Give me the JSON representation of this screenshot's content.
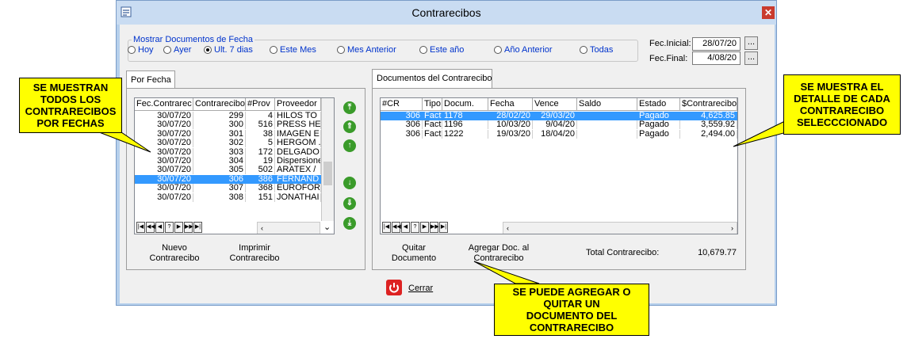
{
  "window": {
    "title": "Contrarecibos",
    "close_glyph": "✕"
  },
  "filter": {
    "legend": "Mostrar Documentos de Fecha",
    "options": [
      {
        "label": "Hoy",
        "selected": false
      },
      {
        "label": "Ayer",
        "selected": false
      },
      {
        "label": "Ult. 7 dias",
        "selected": true
      },
      {
        "label": "Este Mes",
        "selected": false
      },
      {
        "label": "Mes Anterior",
        "selected": false
      },
      {
        "label": "Este año",
        "selected": false
      },
      {
        "label": "Año Anterior",
        "selected": false
      },
      {
        "label": "Todas",
        "selected": false
      }
    ],
    "fec_inicial_label": "Fec.Inicial:",
    "fec_inicial_value": "28/07/20",
    "fec_final_label": "Fec.Final:",
    "fec_final_value": "4/08/20",
    "ellipsis": "..."
  },
  "left_panel": {
    "tab": "Por Fecha",
    "headers": [
      "Fec.Contrarec",
      "Contrarecibo",
      "#Prov",
      "Proveedor"
    ],
    "rows": [
      {
        "fecha": "30/07/20",
        "cr": "299",
        "prov": "4",
        "nombre": "HILOS TO"
      },
      {
        "fecha": "30/07/20",
        "cr": "300",
        "prov": "516",
        "nombre": "PRESS HE"
      },
      {
        "fecha": "30/07/20",
        "cr": "301",
        "prov": "38",
        "nombre": "IMAGEN E"
      },
      {
        "fecha": "30/07/20",
        "cr": "302",
        "prov": "5",
        "nombre": "HERGOM ."
      },
      {
        "fecha": "30/07/20",
        "cr": "303",
        "prov": "172",
        "nombre": "DELGADO"
      },
      {
        "fecha": "30/07/20",
        "cr": "304",
        "prov": "19",
        "nombre": "Dispersione"
      },
      {
        "fecha": "30/07/20",
        "cr": "305",
        "prov": "502",
        "nombre": "ARATEX /"
      },
      {
        "fecha": "30/07/20",
        "cr": "306",
        "prov": "386",
        "nombre": "FERNAND"
      },
      {
        "fecha": "30/07/20",
        "cr": "307",
        "prov": "368",
        "nombre": "EUROFOR"
      },
      {
        "fecha": "30/07/20",
        "cr": "308",
        "prov": "151",
        "nombre": "JONATHAI"
      }
    ],
    "selected_index": 7,
    "nav_glyphs": [
      "|◀",
      "◀◀",
      "◀",
      "?",
      "▶",
      "▶▶",
      "▶|"
    ],
    "btn_nuevo": "Nuevo\nContrarecibo",
    "btn_imprimir": "Imprimir\nContrarecibo"
  },
  "right_panel": {
    "tab": "Documentos del Contrarecibo",
    "headers": [
      "#CR",
      "Tipo",
      "Docum.",
      "Fecha",
      "Vence",
      "Saldo",
      "Estado",
      "$Contrarecibo"
    ],
    "rows": [
      {
        "cr": "306",
        "tipo": "Fact",
        "docum": "1178",
        "fecha": "28/02/20",
        "vence": "29/03/20",
        "saldo": "",
        "estado": "Pagado",
        "monto": "4,625.85"
      },
      {
        "cr": "306",
        "tipo": "Fact",
        "docum": "1196",
        "fecha": "10/03/20",
        "vence": "9/04/20",
        "saldo": "",
        "estado": "Pagado",
        "monto": "3,559.92"
      },
      {
        "cr": "306",
        "tipo": "Fact",
        "docum": "1222",
        "fecha": "19/03/20",
        "vence": "18/04/20",
        "saldo": "",
        "estado": "Pagado",
        "monto": "2,494.00"
      }
    ],
    "selected_index": 0,
    "btn_quitar": "Quitar\nDocumento",
    "btn_agregar": "Agregar Doc. al\nContrarecibo",
    "total_label": "Total Contrarecibo:",
    "total_value": "10,679.77"
  },
  "cerrar": {
    "label": "Cerrar"
  },
  "callouts": {
    "left": "SE MUESTRAN\nTODOS LOS\nCONTRARECIBOS\nPOR FECHAS",
    "right": "SE MUESTRA EL\nDETALLE DE CADA\nCONTRARECIBO\nSELECCCIONADO",
    "bottom": "SE PUEDE AGREGAR O\nQUITAR UN\nDOCUMENTO DEL\nCONTRARECIBO"
  },
  "colors": {
    "selection": "#3399ff",
    "callout": "#ffff00",
    "link_blue": "#0033cc",
    "close_red": "#c93b2e"
  }
}
